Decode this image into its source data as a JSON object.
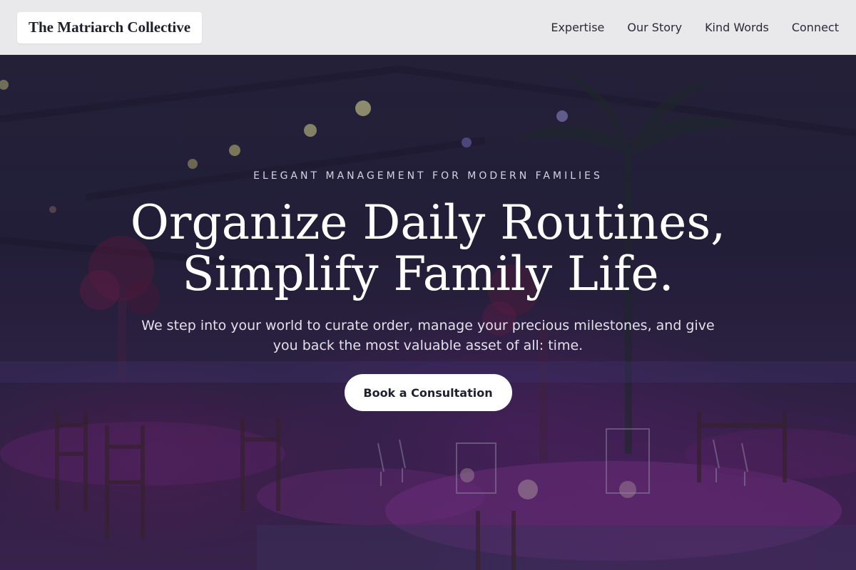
{
  "header": {
    "logo": "The Matriarch Collective",
    "nav": [
      {
        "label": "Expertise"
      },
      {
        "label": "Our Story"
      },
      {
        "label": "Kind Words"
      },
      {
        "label": "Connect"
      }
    ]
  },
  "hero": {
    "eyebrow": "ELEGANT MANAGEMENT FOR MODERN FAMILIES",
    "headline_line1": "Organize Daily Routines,",
    "headline_line2": "Simplify Family Life.",
    "subtext": "We step into your world to curate order, manage your precious milestones, and give you back the most valuable asset of all: time.",
    "cta_label": "Book a Consultation",
    "background_image": "event-dinner-tables-purple-lighting"
  },
  "colors": {
    "header_bg": "#e9e9ec",
    "text_dark": "#2a2b36",
    "hero_tint": "#2a2740",
    "accent_purple": "#8a3aa0",
    "cta_bg": "#ffffff"
  }
}
